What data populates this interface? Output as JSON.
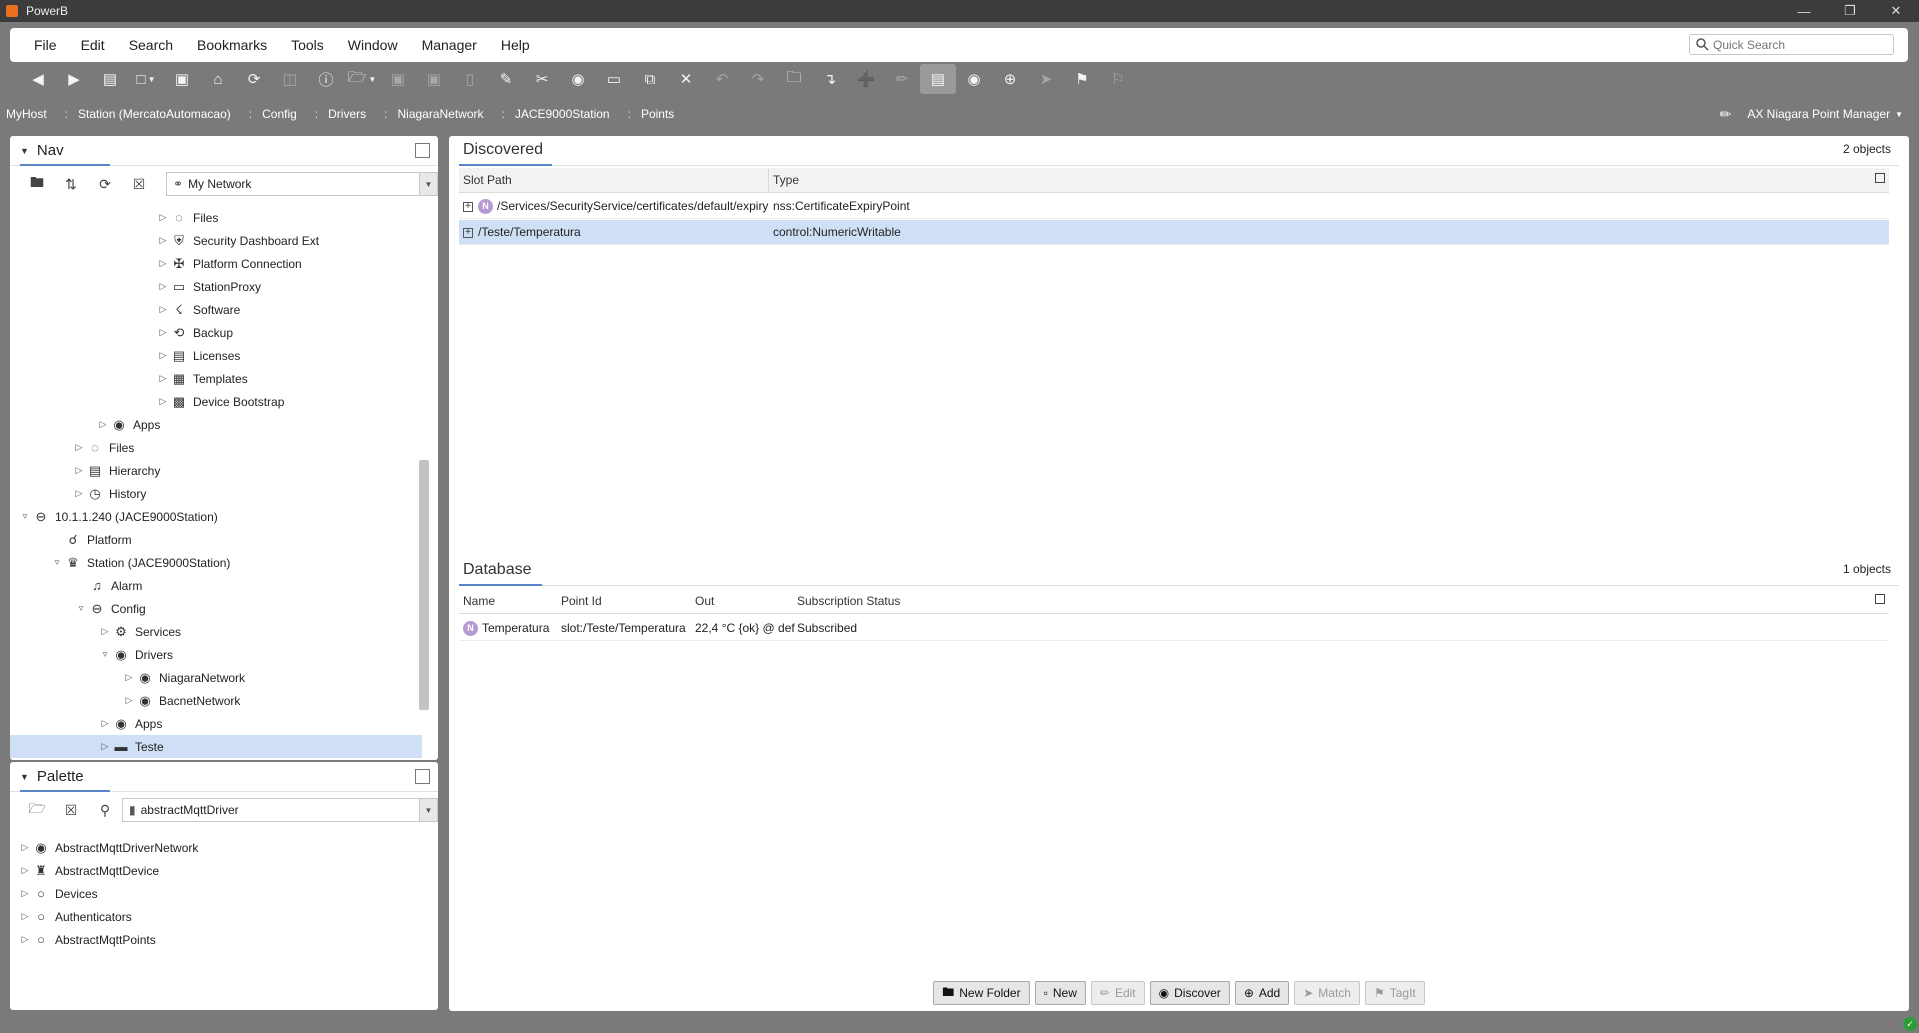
{
  "window": {
    "title": "PowerB"
  },
  "menu": {
    "items": [
      "File",
      "Edit",
      "Search",
      "Bookmarks",
      "Tools",
      "Window",
      "Manager",
      "Help"
    ],
    "quick_search_placeholder": "Quick Search"
  },
  "breadcrumb": {
    "items": [
      "MyHost",
      "Station (MercatoAutomacao)",
      "Config",
      "Drivers",
      "NiagaraNetwork",
      "JACE9000Station",
      "Points"
    ],
    "view": "AX Niagara Point Manager"
  },
  "nav": {
    "title": "Nav",
    "combo_value": "My Network",
    "tree": [
      {
        "label": "Files",
        "icon": "files-icon"
      },
      {
        "label": "Security Dashboard Ext",
        "icon": "shield-icon"
      },
      {
        "label": "Platform Connection",
        "icon": "plug-icon"
      },
      {
        "label": "StationProxy",
        "icon": "monitor-icon"
      },
      {
        "label": "Software",
        "icon": "software-icon"
      },
      {
        "label": "Backup",
        "icon": "backup-icon"
      },
      {
        "label": "Licenses",
        "icon": "license-icon"
      },
      {
        "label": "Templates",
        "icon": "template-icon"
      },
      {
        "label": "Device Bootstrap",
        "icon": "bootstrap-icon"
      },
      {
        "label": "Apps",
        "icon": "apps-icon"
      },
      {
        "label": "Files",
        "icon": "files-icon"
      },
      {
        "label": "Hierarchy",
        "icon": "hierarchy-icon"
      },
      {
        "label": "History",
        "icon": "history-icon"
      },
      {
        "label": "10.1.1.240 (JACE9000Station)",
        "icon": "host-icon"
      },
      {
        "label": "Platform",
        "icon": "platform-icon"
      },
      {
        "label": "Station (JACE9000Station)",
        "icon": "station-icon"
      },
      {
        "label": "Alarm",
        "icon": "bell-icon"
      },
      {
        "label": "Config",
        "icon": "config-icon"
      },
      {
        "label": "Services",
        "icon": "services-icon"
      },
      {
        "label": "Drivers",
        "icon": "drivers-icon"
      },
      {
        "label": "NiagaraNetwork",
        "icon": "network-icon"
      },
      {
        "label": "BacnetNetwork",
        "icon": "network-icon"
      },
      {
        "label": "Apps",
        "icon": "apps-icon"
      },
      {
        "label": "Teste",
        "icon": "folder-icon"
      }
    ]
  },
  "palette": {
    "title": "Palette",
    "combo_value": "abstractMqttDriver",
    "tree": [
      {
        "label": "AbstractMqttDriverNetwork",
        "icon": "network-icon"
      },
      {
        "label": "AbstractMqttDevice",
        "icon": "device-icon"
      },
      {
        "label": "Devices",
        "icon": "folder-icon"
      },
      {
        "label": "Authenticators",
        "icon": "folder-icon"
      },
      {
        "label": "AbstractMqttPoints",
        "icon": "folder-icon"
      }
    ]
  },
  "discovered": {
    "title": "Discovered",
    "count": "2 objects",
    "columns": [
      "Slot Path",
      "Type"
    ],
    "rows": [
      {
        "slot_path": "/Services/SecurityService/certificates/default/expiry",
        "type": "nss:CertificateExpiryPoint",
        "badge": "N"
      },
      {
        "slot_path": "/Teste/Temperatura",
        "type": "control:NumericWritable",
        "badge": ""
      }
    ]
  },
  "database": {
    "title": "Database",
    "count": "1 objects",
    "columns": [
      "Name",
      "Point Id",
      "Out",
      "Subscription Status"
    ],
    "rows": [
      {
        "name": "Temperatura",
        "point_id": "slot:/Teste/Temperatura",
        "out": "22,4 °C {ok} @ def",
        "status": "Subscribed",
        "badge": "N"
      }
    ]
  },
  "buttons": {
    "new_folder": "New Folder",
    "new": "New",
    "edit": "Edit",
    "discover": "Discover",
    "add": "Add",
    "match": "Match",
    "tagit": "TagIt"
  },
  "colors": {
    "accent": "#5b86c5",
    "selection": "#cfe0f6",
    "chrome": "#7a7a7a"
  }
}
